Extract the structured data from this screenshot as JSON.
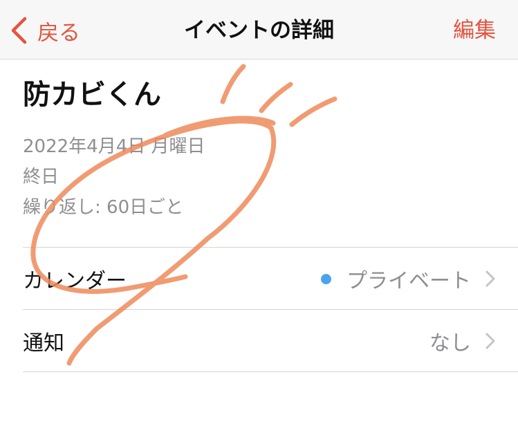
{
  "navbar": {
    "back_label": "戻る",
    "title": "イベントの詳細",
    "edit_label": "編集",
    "accent_color": "#e5533e"
  },
  "event": {
    "title": "防カビくん",
    "date": "2022年4月4日 月曜日",
    "all_day": "終日",
    "repeat": "繰り返し: 60日ごと"
  },
  "rows": {
    "calendar": {
      "label": "カレンダー",
      "value": "プライベート",
      "dot_color": "#4aa3f0"
    },
    "alert": {
      "label": "通知",
      "value": "なし"
    }
  },
  "icons": {
    "back": "chevron-left-icon",
    "disclosure": "chevron-right-icon"
  },
  "annotation": {
    "color": "#ef8a5a"
  }
}
